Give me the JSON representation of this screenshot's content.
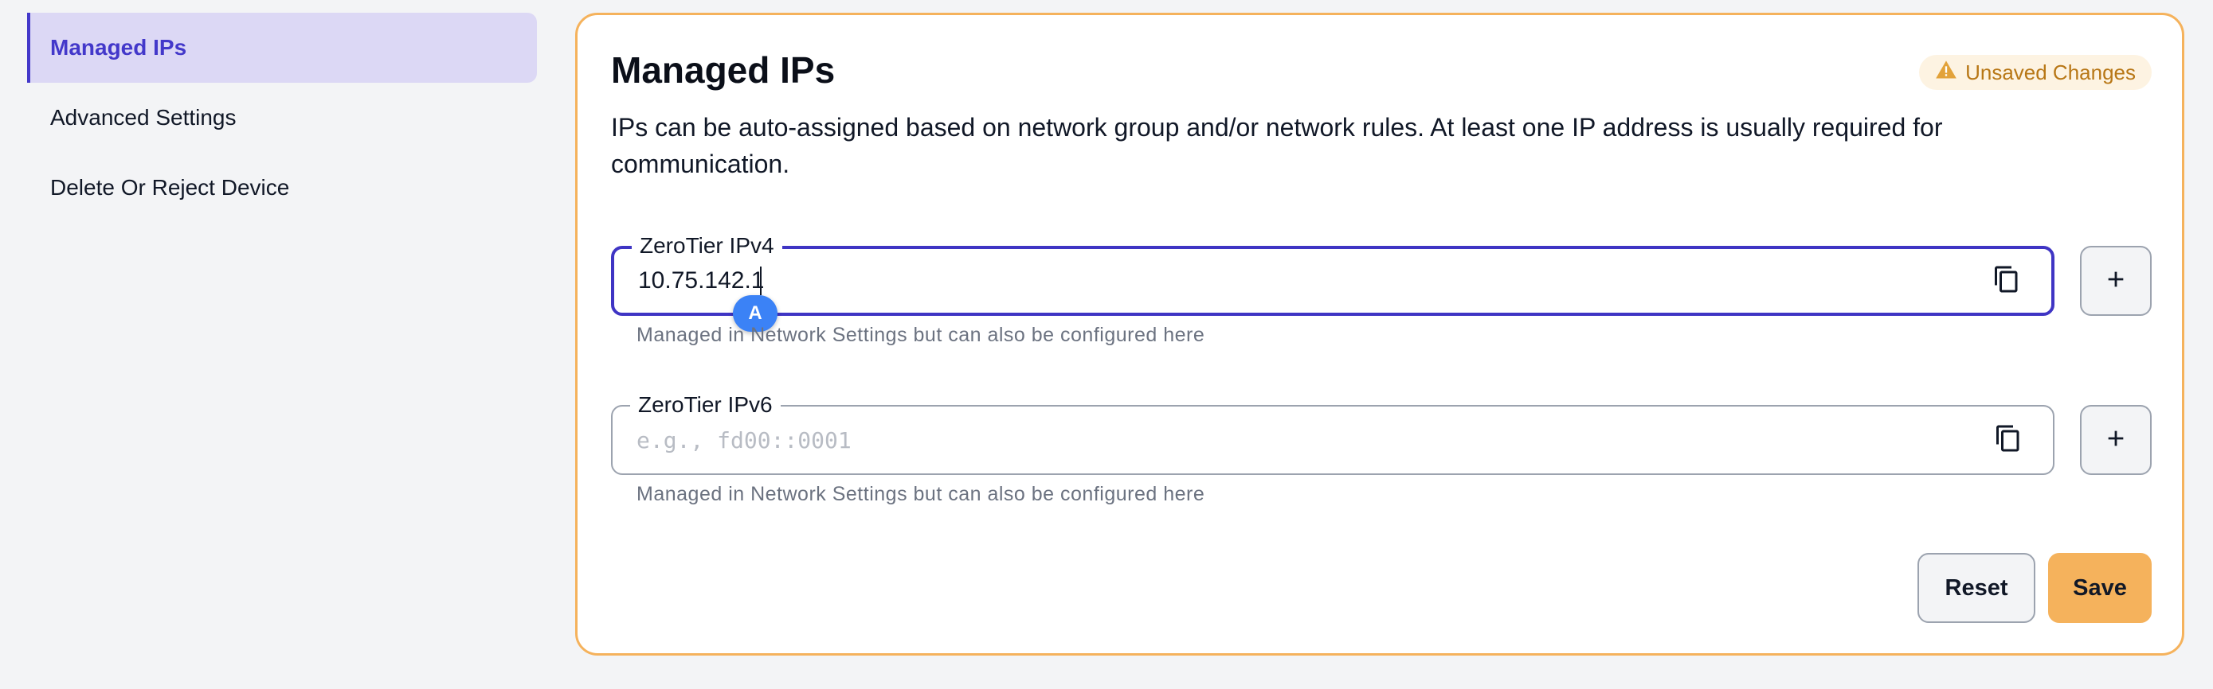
{
  "sidebar": {
    "items": [
      {
        "label": "Managed IPs",
        "active": true
      },
      {
        "label": "Advanced Settings",
        "active": false
      },
      {
        "label": "Delete Or Reject Device",
        "active": false
      }
    ]
  },
  "card": {
    "title": "Managed IPs",
    "badge": {
      "label": "Unsaved Changes",
      "icon": "warning-icon"
    },
    "description": "IPs can be auto-assigned based on network group and/or network rules. At least one IP address is usually required for communication.",
    "ipv4": {
      "label": "ZeroTier IPv4",
      "value": "10.75.142.1",
      "helper": "Managed in Network Settings but can also be configured here"
    },
    "ipv6": {
      "label": "ZeroTier IPv6",
      "value": "",
      "placeholder": "e.g., fd00::0001",
      "helper": "Managed in Network Settings but can also be configured here"
    },
    "cursor_badge": "A",
    "buttons": {
      "reset": "Reset",
      "save": "Save"
    }
  },
  "colors": {
    "accent": "#3f35c4",
    "warning": "#f5b25c",
    "active_bg": "#dcd8f5"
  }
}
